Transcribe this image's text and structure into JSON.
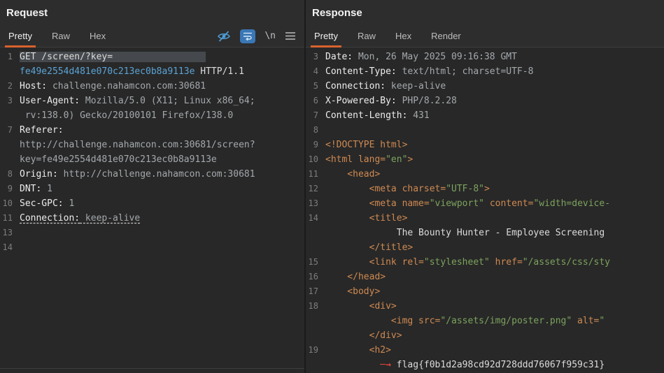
{
  "theme": {
    "accent_orange": "#d8622e",
    "selection_gray": "#45494d",
    "icon_blue": "#4e9bd4",
    "wrap_button_blue": "#3a77b5",
    "tag_orange": "#cf8a52",
    "string_green": "#7da35e",
    "param_cyan": "#5ba3d6",
    "arrow_red": "#e2443a"
  },
  "request": {
    "title": "Request",
    "tabs": [
      {
        "label": "Pretty",
        "active": true
      },
      {
        "label": "Raw",
        "active": false
      },
      {
        "label": "Hex",
        "active": false
      }
    ],
    "toolbar": {
      "newline_label": "\\n",
      "icons": [
        "hide-headers-eye-off-icon",
        "soft-wrap-toggle-icon",
        "newline-chars-toggle",
        "menu-icon"
      ]
    },
    "lines": [
      {
        "num": "1",
        "segs": [
          {
            "t": "GET /screen/?key=",
            "c": "w sel"
          },
          {
            "t": "                 ",
            "c": "sel"
          }
        ]
      },
      {
        "num": "",
        "segs": [
          {
            "t": "fe49e2554d481e070c213ec0b8a9113e",
            "c": "c"
          },
          {
            "t": " HTTP/1.1",
            "c": "w"
          }
        ]
      },
      {
        "num": "2",
        "segs": [
          {
            "t": "Host:",
            "c": "n"
          },
          {
            "t": " challenge.nahamcon.com:30681",
            "c": "v"
          }
        ]
      },
      {
        "num": "3",
        "segs": [
          {
            "t": "User-Agent:",
            "c": "n"
          },
          {
            "t": " Mozilla/5.0 (X11; Linux x86_64;",
            "c": "v"
          }
        ]
      },
      {
        "num": "",
        "segs": [
          {
            "t": " rv:138.0) Gecko/20100101 Firefox/138.0",
            "c": "v"
          }
        ]
      },
      {
        "num": "7",
        "segs": [
          {
            "t": "Referer:",
            "c": "n"
          }
        ]
      },
      {
        "num": "",
        "segs": [
          {
            "t": "http://challenge.nahamcon.com:30681/screen?",
            "c": "v"
          }
        ]
      },
      {
        "num": "",
        "segs": [
          {
            "t": "key=fe49e2554d481e070c213ec0b8a9113e",
            "c": "v"
          }
        ]
      },
      {
        "num": "8",
        "segs": [
          {
            "t": "Origin:",
            "c": "n"
          },
          {
            "t": " http://challenge.nahamcon.com:30681",
            "c": "v"
          }
        ]
      },
      {
        "num": "9",
        "segs": [
          {
            "t": "DNT:",
            "c": "n"
          },
          {
            "t": " 1",
            "c": "v"
          }
        ]
      },
      {
        "num": "10",
        "segs": [
          {
            "t": "Sec-GPC:",
            "c": "n"
          },
          {
            "t": " 1",
            "c": "v"
          }
        ]
      },
      {
        "num": "11",
        "segs": [
          {
            "t": "Connection:",
            "c": "n u"
          },
          {
            "t": " keep-alive",
            "c": "v u"
          }
        ]
      },
      {
        "num": "13",
        "segs": []
      },
      {
        "num": "14",
        "segs": []
      }
    ]
  },
  "response": {
    "title": "Response",
    "tabs": [
      {
        "label": "Pretty",
        "active": true
      },
      {
        "label": "Raw",
        "active": false
      },
      {
        "label": "Hex",
        "active": false
      },
      {
        "label": "Render",
        "active": false
      }
    ],
    "lines": [
      {
        "num": "3",
        "segs": [
          {
            "t": "Date:",
            "c": "n"
          },
          {
            "t": " Mon, 26 May 2025 09:16:38 GMT",
            "c": "v"
          }
        ]
      },
      {
        "num": "4",
        "segs": [
          {
            "t": "Content-Type:",
            "c": "n"
          },
          {
            "t": " text/html; charset=UTF-8",
            "c": "v"
          }
        ]
      },
      {
        "num": "5",
        "segs": [
          {
            "t": "Connection:",
            "c": "n"
          },
          {
            "t": " keep-alive",
            "c": "v"
          }
        ]
      },
      {
        "num": "6",
        "segs": [
          {
            "t": "X-Powered-By:",
            "c": "n"
          },
          {
            "t": " PHP/8.2.28",
            "c": "v"
          }
        ]
      },
      {
        "num": "7",
        "segs": [
          {
            "t": "Content-Length:",
            "c": "n"
          },
          {
            "t": " 431",
            "c": "v"
          }
        ]
      },
      {
        "num": "8",
        "segs": []
      },
      {
        "num": "9",
        "segs": [
          {
            "t": "<!DOCTYPE html>",
            "c": "o"
          }
        ]
      },
      {
        "num": "10",
        "segs": [
          {
            "t": "<html lang=",
            "c": "o"
          },
          {
            "t": "\"en\"",
            "c": "gr"
          },
          {
            "t": ">",
            "c": "o"
          }
        ]
      },
      {
        "num": "11",
        "segs": [
          {
            "t": "    <head>",
            "c": "o"
          }
        ]
      },
      {
        "num": "12",
        "segs": [
          {
            "t": "        <meta charset=",
            "c": "o"
          },
          {
            "t": "\"UTF-8\"",
            "c": "gr"
          },
          {
            "t": ">",
            "c": "o"
          }
        ]
      },
      {
        "num": "13",
        "segs": [
          {
            "t": "        <meta name=",
            "c": "o"
          },
          {
            "t": "\"viewport\"",
            "c": "gr"
          },
          {
            "t": " content=",
            "c": "o"
          },
          {
            "t": "\"width=device-",
            "c": "gr"
          }
        ]
      },
      {
        "num": "14",
        "segs": [
          {
            "t": "        <title>",
            "c": "o"
          }
        ]
      },
      {
        "num": "",
        "segs": [
          {
            "t": "             The Bounty Hunter - Employee Screening",
            "c": "w"
          }
        ]
      },
      {
        "num": "",
        "segs": [
          {
            "t": "        </title>",
            "c": "o"
          }
        ]
      },
      {
        "num": "15",
        "segs": [
          {
            "t": "        <link rel=",
            "c": "o"
          },
          {
            "t": "\"stylesheet\"",
            "c": "gr"
          },
          {
            "t": " href=",
            "c": "o"
          },
          {
            "t": "\"/assets/css/sty",
            "c": "gr"
          }
        ]
      },
      {
        "num": "16",
        "segs": [
          {
            "t": "    </head>",
            "c": "o"
          }
        ]
      },
      {
        "num": "17",
        "segs": [
          {
            "t": "    <body>",
            "c": "o"
          }
        ]
      },
      {
        "num": "18",
        "segs": [
          {
            "t": "        <div>",
            "c": "o"
          }
        ]
      },
      {
        "num": "",
        "segs": [
          {
            "t": "            <img src=",
            "c": "o"
          },
          {
            "t": "\"/assets/img/poster.png\"",
            "c": "gr"
          },
          {
            "t": " alt=",
            "c": "o"
          },
          {
            "t": "\"",
            "c": "gr"
          }
        ]
      },
      {
        "num": "",
        "segs": [
          {
            "t": "        </div>",
            "c": "o"
          }
        ]
      },
      {
        "num": "19",
        "segs": [
          {
            "t": "        <h2>",
            "c": "o"
          }
        ]
      },
      {
        "num": "",
        "segs": [
          {
            "t": "          ",
            "c": "w"
          },
          {
            "t": "─→ ",
            "c": "red"
          },
          {
            "t": "flag{f0b1d2a98cd92d728ddd76067f959c31}",
            "c": "w"
          }
        ]
      }
    ]
  }
}
